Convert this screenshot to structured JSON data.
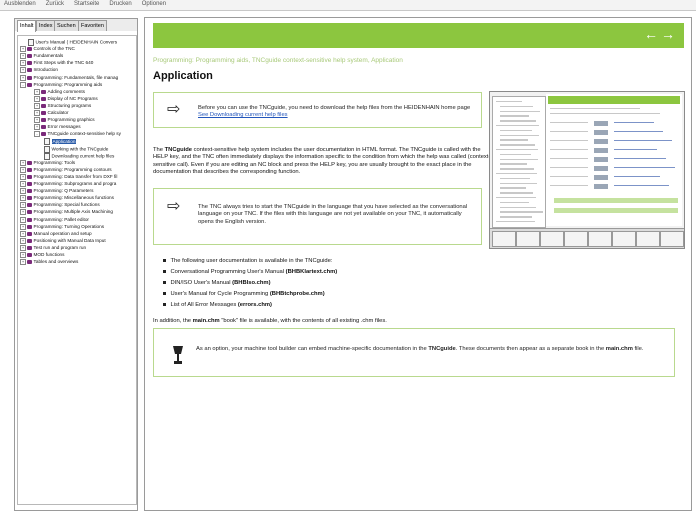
{
  "menu": [
    "Ausblenden",
    "Zurück",
    "Startseite",
    "Drucken",
    "Optionen"
  ],
  "nav_tabs": [
    "Inhalt",
    "Index",
    "Suchen",
    "Favoriten"
  ],
  "tree_items": [
    {
      "label": "User's Manual ( HEIDENHAIN Convers",
      "icon": "page",
      "exp": ""
    },
    {
      "label": "Controls of the TNC",
      "icon": "book",
      "exp": "+"
    },
    {
      "label": "Fundamentals",
      "icon": "book",
      "exp": "+"
    },
    {
      "label": "First Steps with the TNC 640",
      "icon": "book",
      "exp": "+"
    },
    {
      "label": "Introduction",
      "icon": "book",
      "exp": "+"
    },
    {
      "label": "Programming: Fundamentals, file manag",
      "icon": "book",
      "exp": "+"
    },
    {
      "label": "Programming: Programming aids",
      "icon": "book",
      "exp": "-"
    },
    {
      "label": "Adding comments",
      "icon": "book",
      "exp": "+"
    },
    {
      "label": "Display of NC Programs",
      "icon": "book",
      "exp": "+"
    },
    {
      "label": "Structuring programs",
      "icon": "book",
      "exp": "+"
    },
    {
      "label": "Calculator",
      "icon": "book",
      "exp": "+"
    },
    {
      "label": "Programming graphics",
      "icon": "book",
      "exp": "+"
    },
    {
      "label": "Error messages",
      "icon": "book",
      "exp": "+"
    },
    {
      "label": "TNCguide context-sensitive help sy",
      "icon": "book",
      "exp": "-"
    },
    {
      "label": "Application",
      "icon": "page",
      "exp": ""
    },
    {
      "label": "Working with the TNCguide",
      "icon": "page",
      "exp": ""
    },
    {
      "label": "Downloading current help files",
      "icon": "page",
      "exp": ""
    },
    {
      "label": "Programming: Tools",
      "icon": "book",
      "exp": "+"
    },
    {
      "label": "Programming: Programming contours",
      "icon": "book",
      "exp": "+"
    },
    {
      "label": "Programming: Data transfer from DXF fil",
      "icon": "book",
      "exp": "+"
    },
    {
      "label": "Programming: Subprograms and progra",
      "icon": "book",
      "exp": "+"
    },
    {
      "label": "Programming: Q Parameters",
      "icon": "book",
      "exp": "+"
    },
    {
      "label": "Programming: Miscellaneous functions",
      "icon": "book",
      "exp": "+"
    },
    {
      "label": "Programming: Special functions",
      "icon": "book",
      "exp": "+"
    },
    {
      "label": "Programming: Multiple Axis Machining",
      "icon": "book",
      "exp": "+"
    },
    {
      "label": "Programming: Pallet editor",
      "icon": "book",
      "exp": "+"
    },
    {
      "label": "Programming: Turning Operations",
      "icon": "book",
      "exp": "+"
    },
    {
      "label": "Manual operation and setup",
      "icon": "book",
      "exp": "+"
    },
    {
      "label": "Positioning with Manual Data Input",
      "icon": "book",
      "exp": "+"
    },
    {
      "label": "Test run and program run",
      "icon": "book",
      "exp": "+"
    },
    {
      "label": "MOD functions",
      "icon": "book",
      "exp": "+"
    },
    {
      "label": "Tables and overviews",
      "icon": "book",
      "exp": "+"
    }
  ],
  "content": {
    "breadcrumb": "Programming: Programming aids, TNCguide context-sensitive help system, Application",
    "title": "Application",
    "box1_text": "Before you can use the TNCguide, you need to download the help files from the HEIDENHAIN home page",
    "box1_link": "See Downloading current help files",
    "para1_bold": "TNCguide",
    "para1_pre": "The ",
    "para1": " context-sensitive help system includes the user documentation in HTML format. The TNCguide is called with the HELP key, and the TNC often immediately displays the information specific to the condition from which the help was called (context-sensitive call). Even if you are editing an NC block and press the HELP key, you are usually brought to the exact place in the documentation that describes the corresponding function.",
    "box2_text": "The TNC always tries to start the TNCguide in the language that you have selected as the conversational language on your TNC. If the files with this language are not yet available on your TNC, it automatically opens the English version.",
    "list_intro": "The following user documentation is available in the TNCguide:",
    "list": [
      {
        "text": "Conversational Programming User's Manual ",
        "bold": "(BHBKlartext.chm)"
      },
      {
        "text": "DIN/ISO User's Manual ",
        "bold": "(BHBIso.chm)"
      },
      {
        "text": "User's Manual for Cycle Programming ",
        "bold": "(BHBtchprobe.chm)"
      },
      {
        "text": "List of All Error Messages ",
        "bold": "(errors.chm)"
      }
    ],
    "para2_pre": "In addition, the ",
    "para2_bold": "main.chm",
    "para2_post": " \"book\" file is available, with the contents of all existing .chm files.",
    "box3_pre": "As an option, your machine tool builder can embed machine-specific documentation in the ",
    "box3_bold1": "TNCguide",
    "box3_mid": ". These documents then appear as a separate book in the ",
    "box3_bold2": "main.chm",
    "box3_post": " file."
  },
  "colors": {
    "accent": "#8cc63f",
    "breadcrumb": "#a8c979",
    "box_border": "#b9d98e",
    "link": "#2255bb"
  }
}
